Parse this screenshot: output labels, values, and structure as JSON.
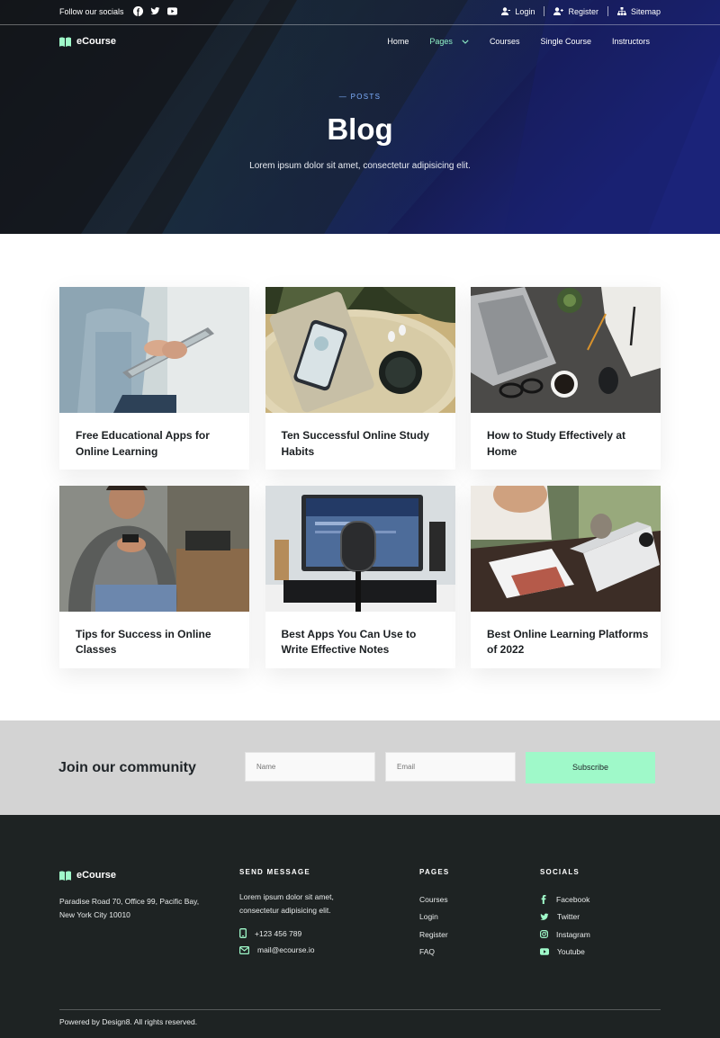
{
  "topbar": {
    "follow_label": "Follow our socials",
    "social_icons": [
      "facebook-icon",
      "twitter-icon",
      "youtube-icon"
    ],
    "links": [
      {
        "label": "Login",
        "icon": "user-icon"
      },
      {
        "label": "Register",
        "icon": "user-plus-icon"
      },
      {
        "label": "Sitemap",
        "icon": "sitemap-icon"
      }
    ]
  },
  "nav": {
    "brand": "eCourse",
    "items": [
      {
        "label": "Home",
        "active": false
      },
      {
        "label": "Pages",
        "active": true,
        "dropdown": true
      },
      {
        "label": "Courses",
        "active": false
      },
      {
        "label": "Single Course",
        "active": false
      },
      {
        "label": "Instructors",
        "active": false
      }
    ]
  },
  "hero": {
    "kicker": "— POSTS",
    "title": "Blog",
    "subtitle": "Lorem ipsum dolor sit amet, consectetur adipisicing elit."
  },
  "posts": [
    {
      "title": "Free Educational Apps for Online Learning"
    },
    {
      "title": "Ten Successful Online Study Habits"
    },
    {
      "title": "How to Study Effectively at Home"
    },
    {
      "title": "Tips for Success in Online Classes"
    },
    {
      "title": "Best Apps You Can Use to Write Effective Notes"
    },
    {
      "title": "Best Online Learning Platforms of 2022"
    }
  ],
  "community": {
    "title": "Join our community",
    "name_placeholder": "Name",
    "email_placeholder": "Email",
    "button": "Subscribe"
  },
  "footer": {
    "brand": "eCourse",
    "address": "Paradise Road 70, Office 99, Pacific Bay,  New York City 10010",
    "send_message": {
      "heading": "SEND MESSAGE",
      "text": "Lorem ipsum dolor sit amet, consectetur adipisicing elit.",
      "phone": "+123 456 789",
      "email": "mail@ecourse.io"
    },
    "pages": {
      "heading": "PAGES",
      "links": [
        "Courses",
        "Login",
        "Register",
        "FAQ"
      ]
    },
    "socials": {
      "heading": "SOCIALS",
      "links": [
        "Facebook",
        "Twitter",
        "Instagram",
        "Youtube"
      ]
    },
    "copyright": "Powered by Design8. All rights reserved."
  },
  "colors": {
    "accent": "#9ff9c9",
    "hero_bg": "#14171c",
    "footer_bg": "#1e2323",
    "band_bg": "#d3d3d3"
  }
}
